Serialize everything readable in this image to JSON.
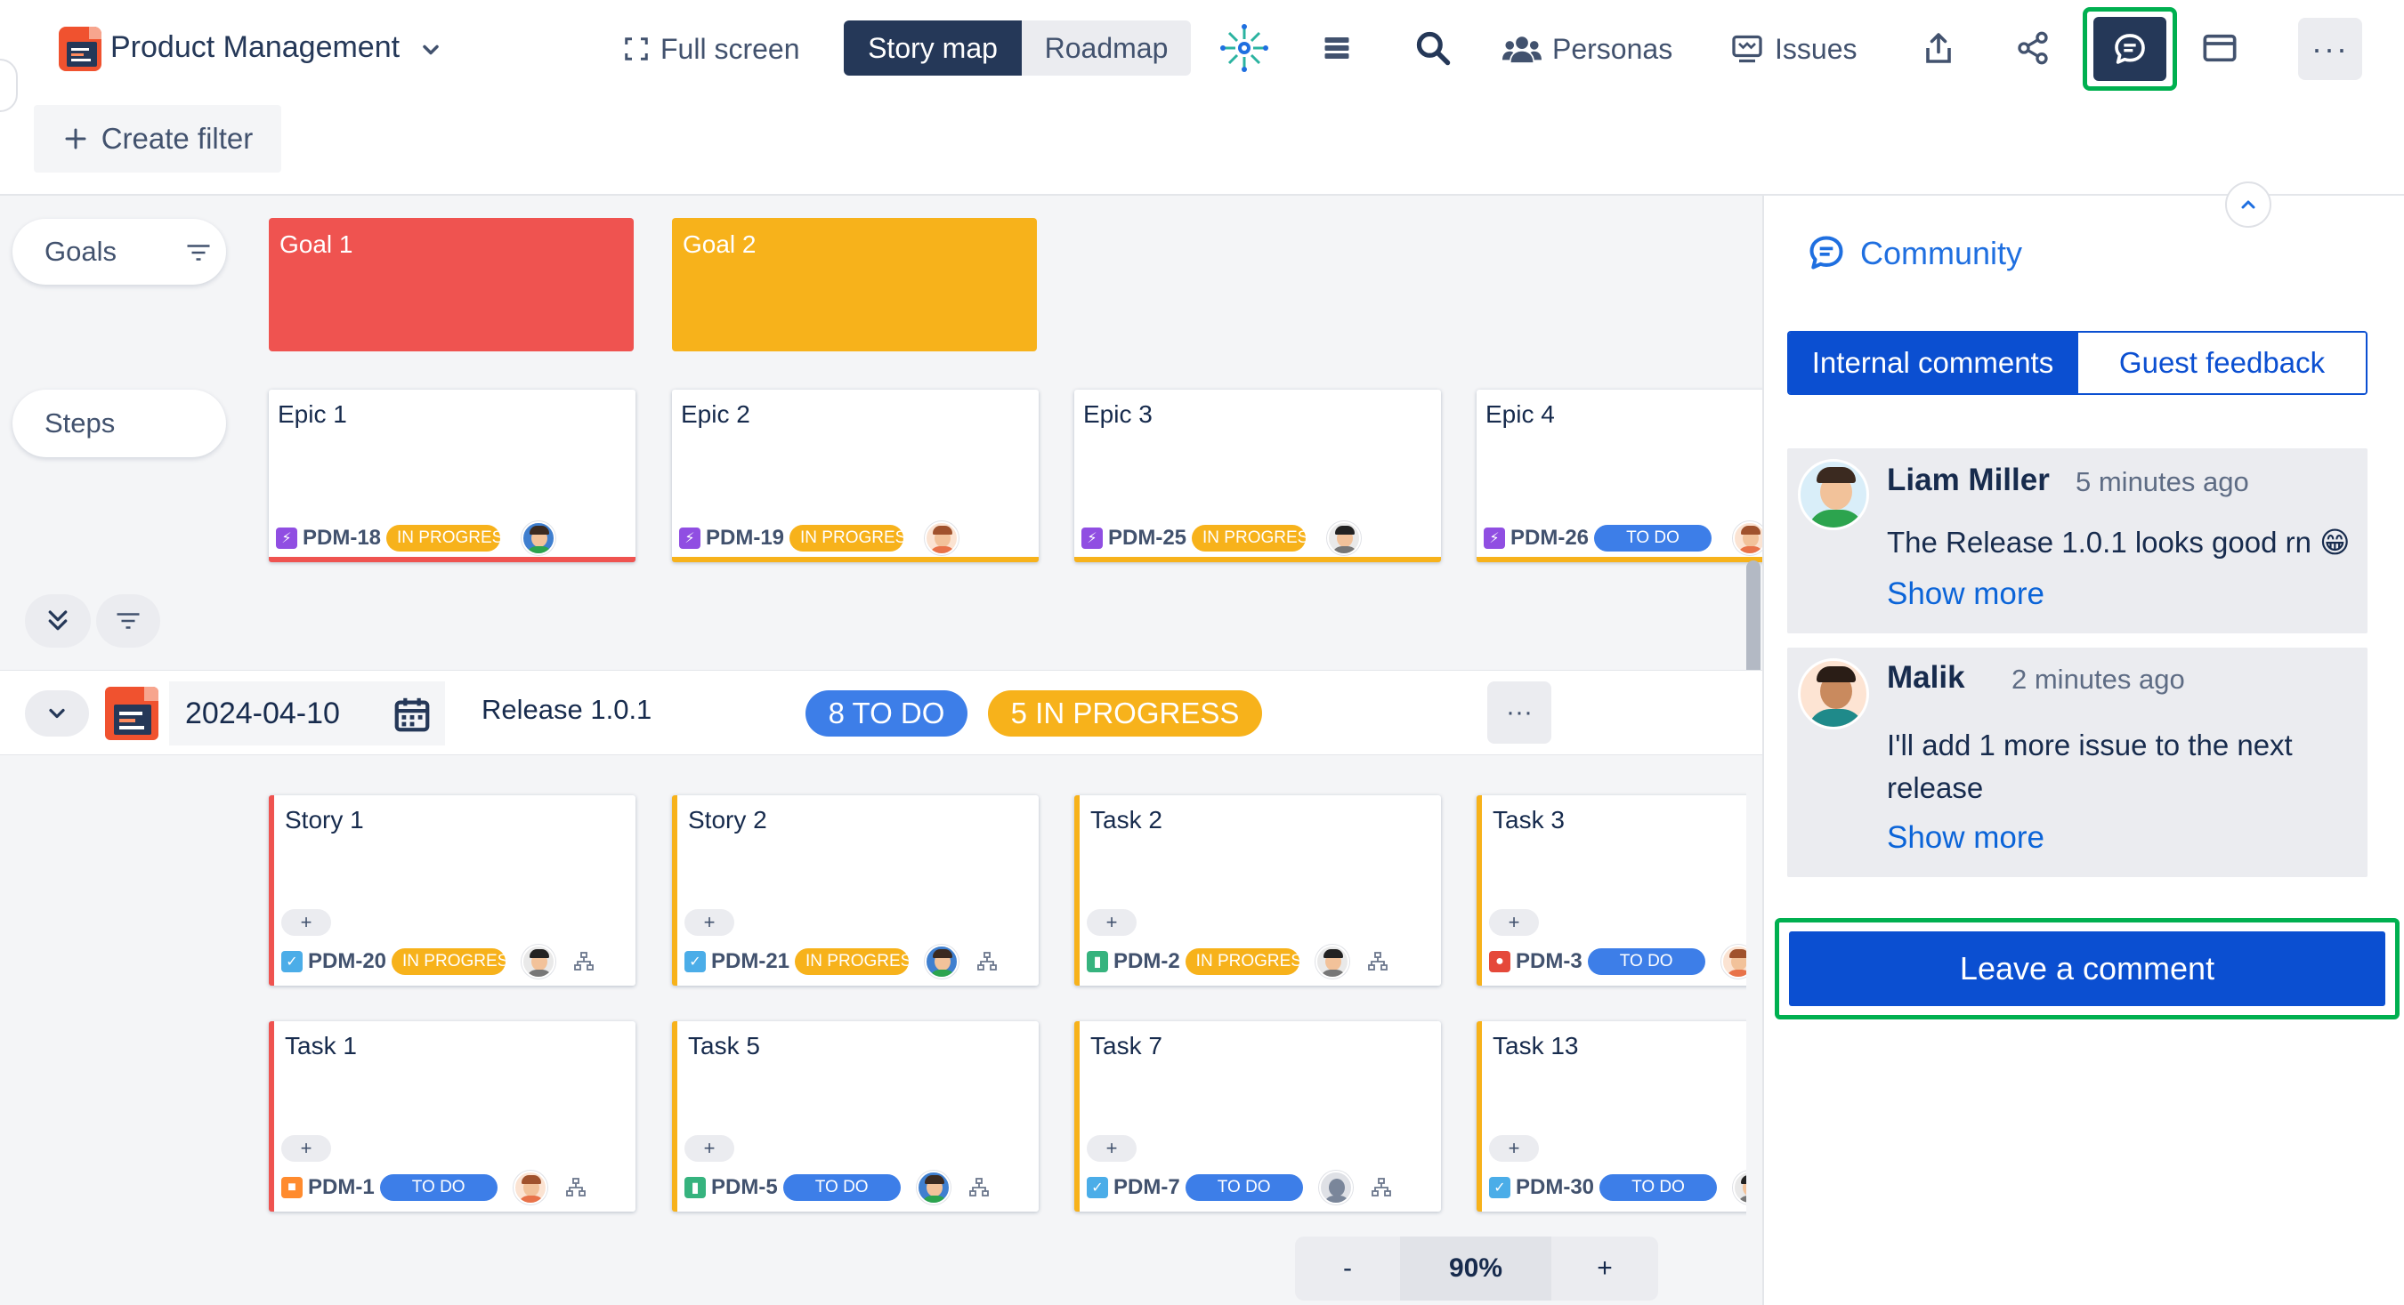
{
  "header": {
    "app_title": "Product Management",
    "full_screen": "Full screen",
    "view_tabs": [
      "Story map",
      "Roadmap"
    ],
    "personas": "Personas",
    "issues": "Issues",
    "more": "···",
    "create_filter": "Create filter"
  },
  "board": {
    "goals_label": "Goals",
    "steps_label": "Steps",
    "goals": [
      {
        "title": "Goal 1",
        "color": "#ef5350"
      },
      {
        "title": "Goal 2",
        "color": "#f7b21b"
      }
    ],
    "epics": [
      {
        "title": "Epic 1",
        "key": "PDM-18",
        "status": "IN PROGRESS",
        "border": "#ef5350"
      },
      {
        "title": "Epic 2",
        "key": "PDM-19",
        "status": "IN PROGRESS",
        "border": "#f7b21b"
      },
      {
        "title": "Epic 3",
        "key": "PDM-25",
        "status": "IN PROGRESS",
        "border": "#f7b21b"
      },
      {
        "title": "Epic 4",
        "key": "PDM-26",
        "status": "TO DO",
        "border": "#f7b21b"
      }
    ],
    "release": {
      "date": "2024-04-10",
      "name": "Release 1.0.1",
      "todo_badge": "8 TO DO",
      "progress_badge": "5 IN PROGRESS",
      "more": "···"
    },
    "cards_row1": [
      {
        "title": "Story 1",
        "key": "PDM-20",
        "status": "IN PROGRESS",
        "type": "checkbox"
      },
      {
        "title": "Story 2",
        "key": "PDM-21",
        "status": "IN PROGRESS",
        "type": "checkbox"
      },
      {
        "title": "Task 2",
        "key": "PDM-2",
        "status": "IN PROGRESS",
        "type": "bookmark"
      },
      {
        "title": "Task 3",
        "key": "PDM-3",
        "status": "TO DO",
        "type": "bug"
      }
    ],
    "cards_row2": [
      {
        "title": "Task 1",
        "key": "PDM-1",
        "status": "TO DO",
        "type": "lock"
      },
      {
        "title": "Task 5",
        "key": "PDM-5",
        "status": "TO DO",
        "type": "bookmark"
      },
      {
        "title": "Task 7",
        "key": "PDM-7",
        "status": "TO DO",
        "type": "checkbox"
      },
      {
        "title": "Task 13",
        "key": "PDM-30",
        "status": "TO DO",
        "type": "checkbox"
      }
    ],
    "plus": "+",
    "zoom": {
      "minus": "-",
      "level": "90%",
      "plus": "+"
    }
  },
  "panel": {
    "title": "Community",
    "tabs": [
      "Internal comments",
      "Guest feedback"
    ],
    "comments": [
      {
        "author": "Liam Miller",
        "time": "5 minutes ago",
        "text": "The Release 1.0.1 looks good rn 😁",
        "more": "Show more"
      },
      {
        "author": "Malik",
        "time": "2 minutes ago",
        "text_line1": "I'll add 1 more issue to the next",
        "text_line2": "release",
        "more": "Show more"
      }
    ],
    "leave_comment": "Leave a comment"
  },
  "colors": {
    "navy": "#253858",
    "blue": "#0b4fd1",
    "red": "#ef5350",
    "amber": "#f7b21b",
    "todo": "#3d7ee8",
    "highlight": "#00b050"
  }
}
